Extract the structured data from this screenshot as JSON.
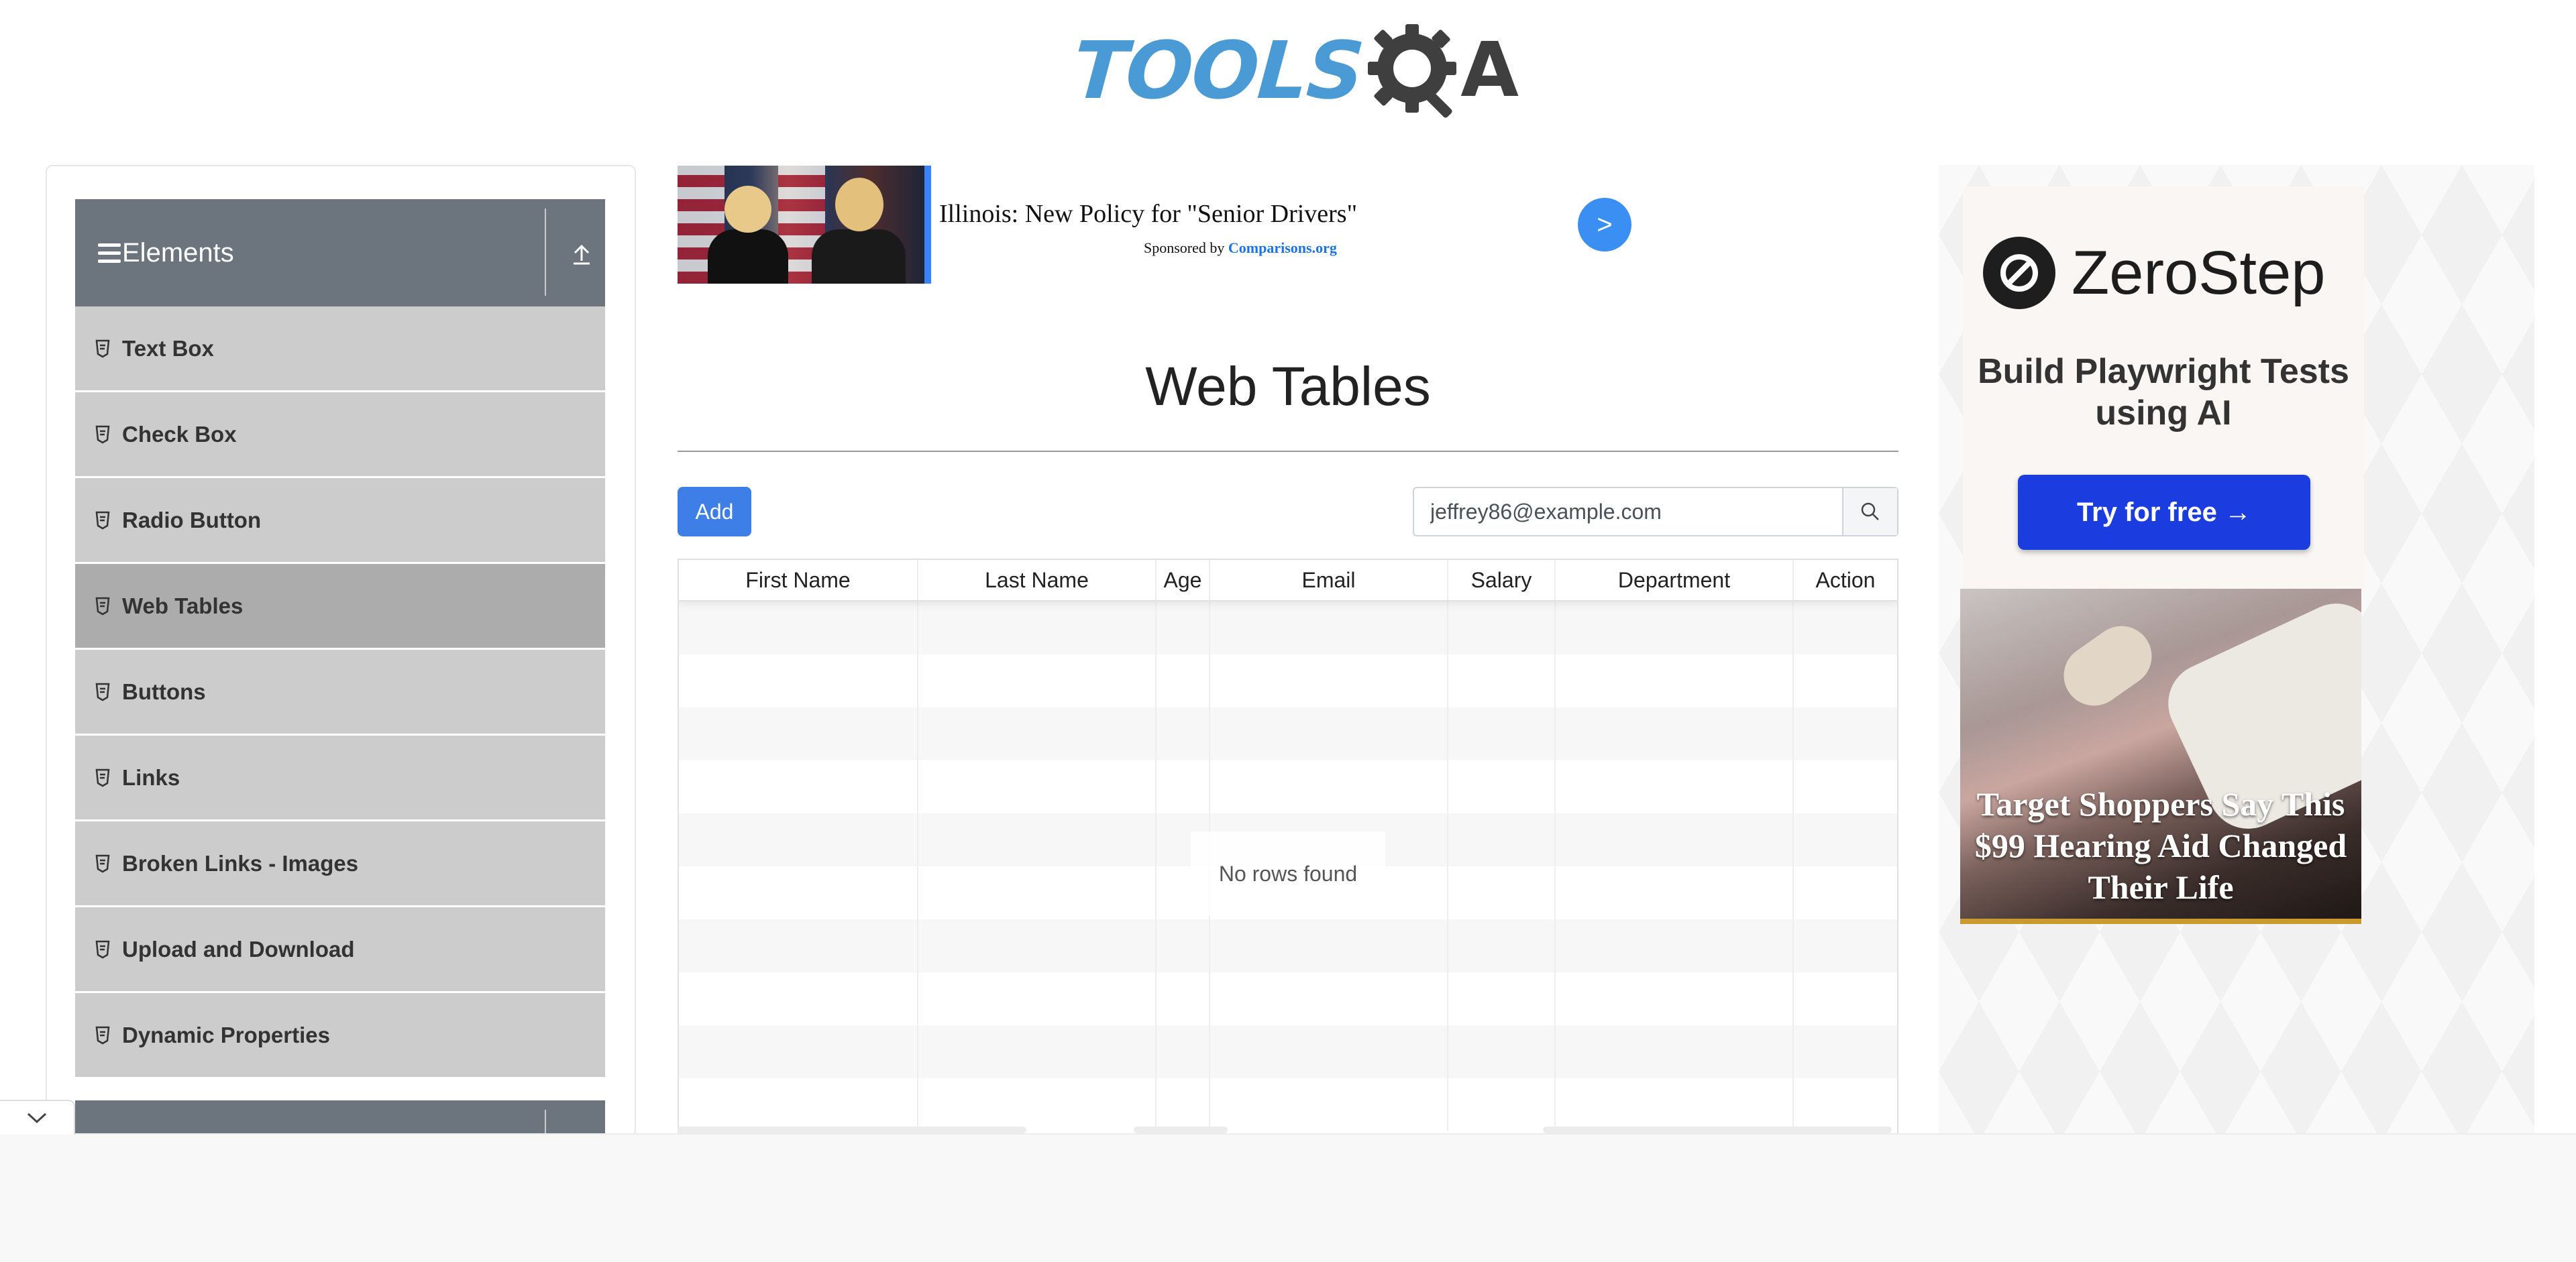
{
  "logo": {
    "part1": "TOOLS",
    "part2": "A"
  },
  "sidebar": {
    "group_title": "Elements",
    "items": [
      {
        "label": "Text Box"
      },
      {
        "label": "Check Box"
      },
      {
        "label": "Radio Button"
      },
      {
        "label": "Web Tables",
        "active": true
      },
      {
        "label": "Buttons"
      },
      {
        "label": "Links"
      },
      {
        "label": "Broken Links - Images"
      },
      {
        "label": "Upload and Download"
      },
      {
        "label": "Dynamic Properties"
      }
    ]
  },
  "ad_top": {
    "headline": "Illinois: New Policy for \"Senior Drivers\"",
    "sponsored_prefix": "Sponsored by ",
    "sponsor": "Comparisons.org",
    "arrow": ">"
  },
  "main": {
    "title": "Web Tables",
    "add_label": "Add",
    "search": {
      "value": "jeffrey86@example.com",
      "placeholder": "Type to search"
    },
    "table": {
      "columns": [
        "First Name",
        "Last Name",
        "Age",
        "Email",
        "Salary",
        "Department",
        "Action"
      ],
      "empty_text": "No rows found"
    }
  },
  "ad_right": {
    "brand": "ZeroStep",
    "tagline": "Build Playwright Tests using AI",
    "cta": "Try for free →",
    "promo_headline": "Target Shoppers Say This $99 Hearing Aid Changed Their Life"
  },
  "colors": {
    "primary": "#3d7fe6",
    "sidebar_header": "#6c757d",
    "sidebar_item": "#cccccc",
    "sidebar_item_active": "#acacac",
    "cta_blue": "#1b3de0"
  },
  "icons": [
    "gear-logo-icon",
    "hamburger-icon",
    "collapse-arrow-icon",
    "element-badge-icon",
    "search-icon",
    "chevron-down-icon"
  ]
}
